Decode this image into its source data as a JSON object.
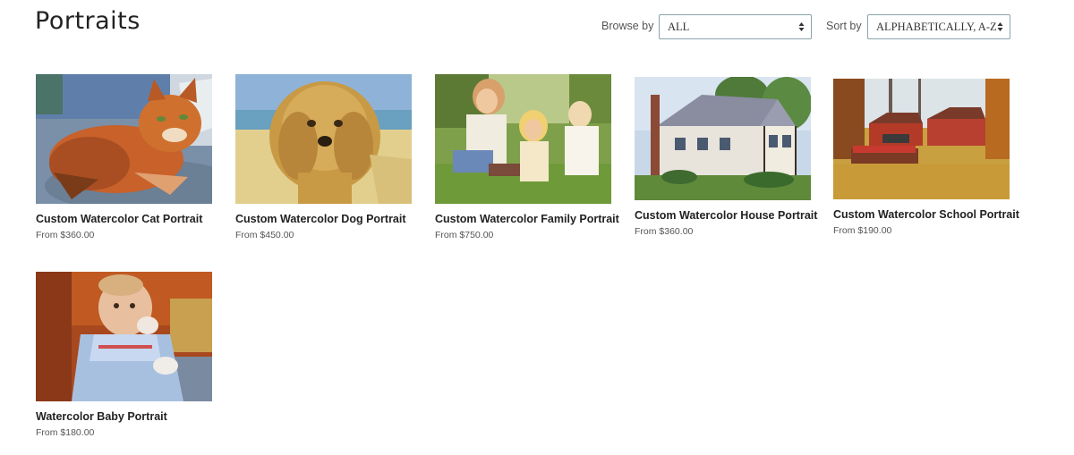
{
  "page": {
    "title": "Portraits"
  },
  "filters": {
    "browse_label": "Browse by",
    "browse_value": "ALL",
    "sort_label": "Sort by",
    "sort_value": "ALPHABETICALLY, A-Z"
  },
  "products": [
    {
      "title": "Custom Watercolor Cat Portrait",
      "price": "From $360.00",
      "image": "watercolor cat portrait"
    },
    {
      "title": "Custom Watercolor Dog Portrait",
      "price": "From $450.00",
      "image": "watercolor dog portrait"
    },
    {
      "title": "Custom Watercolor Family Portrait",
      "price": "From $750.00",
      "image": "watercolor family portrait"
    },
    {
      "title": "Custom Watercolor House Portrait",
      "price": "From $360.00",
      "image": "watercolor house portrait"
    },
    {
      "title": "Custom Watercolor School Portrait",
      "price": "From $190.00",
      "image": "watercolor school portrait"
    },
    {
      "title": "Watercolor Baby Portrait",
      "price": "From $180.00",
      "image": "watercolor baby portrait"
    }
  ]
}
